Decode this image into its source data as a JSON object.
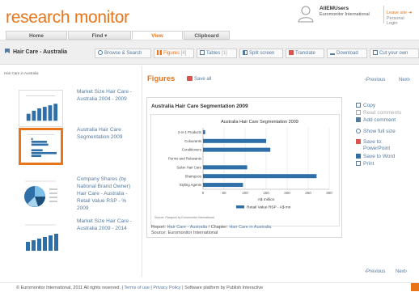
{
  "app": {
    "logo": "research monitor"
  },
  "user": {
    "name": "AllEMUsers",
    "org": "Euromonitor International",
    "leave_site": "Leave site",
    "personal_login": "Personal Login"
  },
  "nav": {
    "tabs": [
      {
        "label": "Home"
      },
      {
        "label": "Find ▾"
      },
      {
        "label": "View",
        "active": true
      },
      {
        "label": "Clipboard"
      }
    ]
  },
  "toolbar": {
    "breadcrumb": "Hair Care - Australia",
    "buttons": [
      {
        "label": "Browse & Search",
        "count": ""
      },
      {
        "label": "Figures",
        "count": "[4]",
        "active": true
      },
      {
        "label": "Tables",
        "count": "[1]"
      },
      {
        "label": "Split screen",
        "count": ""
      },
      {
        "label": "Translate",
        "count": ""
      },
      {
        "label": "Download",
        "count": ""
      },
      {
        "label": "Cut your own",
        "count": ""
      }
    ]
  },
  "sidebar": {
    "title": "Hair Care in Australia",
    "items": [
      {
        "label": "Market Size Hair Care - Australia 2004 - 2009"
      },
      {
        "label": "Australia Hair Care Segmentation 2009",
        "selected": true
      },
      {
        "label": "Company Shares (by National Brand Owner) Hair Care - Australia - Retail Value RSP - % 2009"
      },
      {
        "label": "Market Size Hair Care - Australia 2009 - 2014"
      }
    ]
  },
  "main": {
    "heading": "Figures",
    "save_all": "Save all",
    "previous": "Previous",
    "next": "Next",
    "figure_title": "Australia Hair Care Segmentation 2009",
    "report_prefix": "Report:",
    "report_link": "Hair Care - Australia",
    "chapter_prefix": "/ Chapter:",
    "chapter_link": "Hair Care in Australia",
    "source": "Source: Euromonitor International"
  },
  "actions": {
    "copy": "Copy",
    "read_comments": "Read comments",
    "add_comment": "Add comment",
    "show_full_size": "Show full size",
    "save_to": "Save to:",
    "powerpoint": "PowerPoint",
    "save_word": "Save to Word",
    "print": "Print"
  },
  "footer": {
    "copyright": "© Euromonitor International, 2011 All rights reserved.",
    "sep": "|",
    "terms": "Terms of use",
    "privacy": "Privacy Policy",
    "software": "Software platform by Publish Interactive"
  },
  "colors": {
    "accent": "#e8751a",
    "link": "#557a9e",
    "bar": "#2f6fa8"
  },
  "chart_data": {
    "type": "bar",
    "orientation": "horizontal",
    "title": "Australia Hair Care Segmentation 2009",
    "categories": [
      "2-in-1 Products",
      "Colourants",
      "Conditioners",
      "Perms and Relaxants",
      "Salon Hair Care",
      "Shampoos",
      "Styling Agents"
    ],
    "series": [
      {
        "name": "Retail Value RSP - A$ mn",
        "values": [
          5,
          150,
          160,
          0,
          105,
          270,
          95
        ]
      }
    ],
    "xlabel": "A$ million",
    "xlim": [
      0,
      300
    ],
    "xticks": [
      "0",
      "50",
      "100",
      "150",
      "200",
      "250",
      "300"
    ],
    "grid": true,
    "legend": "bottom",
    "source": "Source: Passport by Euromonitor International"
  }
}
